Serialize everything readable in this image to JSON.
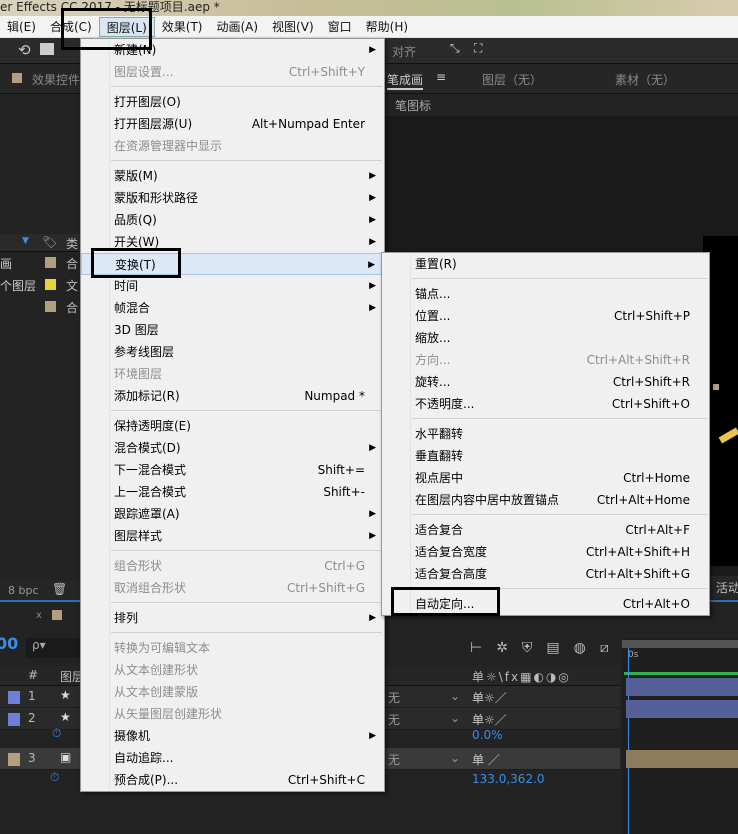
{
  "window": {
    "title": "er Effects CC 2017 - 无标题项目.aep *"
  },
  "menubar": {
    "items": [
      "辑(E)",
      "合成(C)",
      "图层(L)",
      "效果(T)",
      "动画(A)",
      "视图(V)",
      "窗口",
      "帮助(H)"
    ],
    "active_index": 2
  },
  "toolbar": {
    "align_label": "对齐"
  },
  "panels": {
    "effects_tab": "效果控件",
    "comp_tab": "笔成画",
    "comp_sub": "笔图标",
    "layer_tab": "图层（无）",
    "footage_tab": "素材（无）",
    "project_col_type": "类",
    "project_items": [
      {
        "name": "画",
        "type": "合",
        "color": "#b39f7f"
      },
      {
        "name": "个图层",
        "type": "文",
        "color": "#e4d33c"
      },
      {
        "name": "",
        "type": "合",
        "color": "#b39f7f"
      }
    ],
    "bpc": "8 bpc",
    "workspace": "活动"
  },
  "timeline": {
    "time": "00",
    "search_placeholder": "ρ▾",
    "col_num": "#",
    "col_name": "图层",
    "ruler_label": "0s",
    "layers": [
      {
        "num": "1",
        "color": "#6f7fd8"
      },
      {
        "num": "2",
        "color": "#6f7fd8"
      },
      {
        "num": "3",
        "color": "#b39f7f"
      }
    ],
    "opacity_value": "0.0%",
    "position_value": "133.0,362.0",
    "mode_glyph": "无"
  },
  "layer_menu": {
    "items": [
      {
        "label": "新建(N)",
        "submenu": true
      },
      {
        "label": "图层设置...",
        "shortcut": "Ctrl+Shift+Y",
        "disabled": true
      },
      {
        "sep": true
      },
      {
        "label": "打开图层(O)"
      },
      {
        "label": "打开图层源(U)",
        "shortcut": "Alt+Numpad Enter"
      },
      {
        "label": "在资源管理器中显示",
        "disabled": true
      },
      {
        "sep": true
      },
      {
        "label": "蒙版(M)",
        "submenu": true
      },
      {
        "label": "蒙版和形状路径",
        "submenu": true
      },
      {
        "label": "品质(Q)",
        "submenu": true
      },
      {
        "label": "开关(W)",
        "submenu": true
      },
      {
        "label": "变换(T)",
        "submenu": true,
        "highlighted": true
      },
      {
        "label": "时间",
        "submenu": true
      },
      {
        "label": "帧混合",
        "submenu": true
      },
      {
        "label": "3D 图层"
      },
      {
        "label": "参考线图层"
      },
      {
        "label": "环境图层",
        "disabled": true
      },
      {
        "label": "添加标记(R)",
        "shortcut": "Numpad *"
      },
      {
        "sep": true
      },
      {
        "label": "保持透明度(E)"
      },
      {
        "label": "混合模式(D)",
        "submenu": true
      },
      {
        "label": "下一混合模式",
        "shortcut": "Shift+="
      },
      {
        "label": "上一混合模式",
        "shortcut": "Shift+-"
      },
      {
        "label": "跟踪遮罩(A)",
        "submenu": true
      },
      {
        "label": "图层样式",
        "submenu": true
      },
      {
        "sep": true
      },
      {
        "label": "组合形状",
        "shortcut": "Ctrl+G",
        "disabled": true
      },
      {
        "label": "取消组合形状",
        "shortcut": "Ctrl+Shift+G",
        "disabled": true
      },
      {
        "sep": true
      },
      {
        "label": "排列",
        "submenu": true
      },
      {
        "sep": true
      },
      {
        "label": "转换为可编辑文本",
        "disabled": true
      },
      {
        "label": "从文本创建形状",
        "disabled": true
      },
      {
        "label": "从文本创建蒙版",
        "disabled": true
      },
      {
        "label": "从矢量图层创建形状",
        "disabled": true
      },
      {
        "label": "摄像机",
        "submenu": true
      },
      {
        "label": "自动追踪..."
      },
      {
        "label": "预合成(P)...",
        "shortcut": "Ctrl+Shift+C"
      }
    ]
  },
  "transform_menu": {
    "items": [
      {
        "label": "重置(R)"
      },
      {
        "sep": true
      },
      {
        "label": "锚点..."
      },
      {
        "label": "位置...",
        "shortcut": "Ctrl+Shift+P"
      },
      {
        "label": "缩放..."
      },
      {
        "label": "方向...",
        "shortcut": "Ctrl+Alt+Shift+R",
        "disabled": true
      },
      {
        "label": "旋转...",
        "shortcut": "Ctrl+Shift+R"
      },
      {
        "label": "不透明度...",
        "shortcut": "Ctrl+Shift+O"
      },
      {
        "sep": true
      },
      {
        "label": "水平翻转"
      },
      {
        "label": "垂直翻转"
      },
      {
        "label": "视点居中",
        "shortcut": "Ctrl+Home"
      },
      {
        "label": "在图层内容中居中放置锚点",
        "shortcut": "Ctrl+Alt+Home"
      },
      {
        "sep": true
      },
      {
        "label": "适合复合",
        "shortcut": "Ctrl+Alt+F"
      },
      {
        "label": "适合复合宽度",
        "shortcut": "Ctrl+Alt+Shift+H"
      },
      {
        "label": "适合复合高度",
        "shortcut": "Ctrl+Alt+Shift+G"
      },
      {
        "sep": true
      },
      {
        "label": "自动定向...",
        "shortcut": "Ctrl+Alt+O"
      }
    ]
  }
}
